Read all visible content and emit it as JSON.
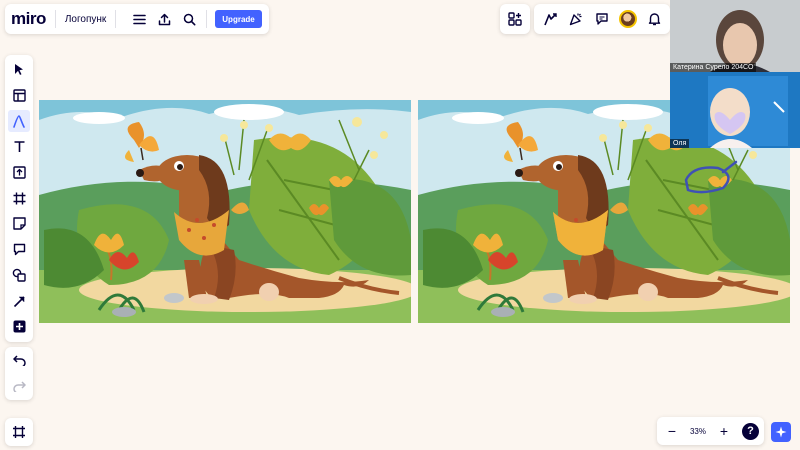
{
  "app": {
    "logo": "miro",
    "board_name": "Логопунк",
    "upgrade_label": "Upgrade"
  },
  "icons": {
    "board_bar": [
      "menu-icon",
      "export-icon",
      "search-icon"
    ],
    "collab_bar": [
      "apps-icon",
      "reactions-icon",
      "celebrate-icon",
      "comments-icon",
      "avatar",
      "bell-icon"
    ],
    "left_toolbar": [
      "select-cursor-icon",
      "templates-icon",
      "pen-icon",
      "text-icon",
      "upload-icon",
      "frame-icon",
      "sticky-note-icon",
      "comment-icon",
      "shapes-icon",
      "connector-arrow-icon",
      "plus-icon"
    ],
    "history": [
      "undo-icon",
      "redo-icon"
    ],
    "frames": "frames-list-icon"
  },
  "video": {
    "participant_1": "Катерина Сурело 204СО",
    "participant_2": "Оля"
  },
  "zoom": {
    "minus": "−",
    "level": "33%",
    "plus": "+",
    "help": "?"
  },
  "colors": {
    "accent": "#4262ff",
    "canvas": "#fcf6f0",
    "annotation_ink": "#3f51b5"
  },
  "canvas": {
    "images": [
      "spot-the-difference-left",
      "spot-the-difference-right"
    ],
    "annotation": "circle drawn around difference"
  }
}
